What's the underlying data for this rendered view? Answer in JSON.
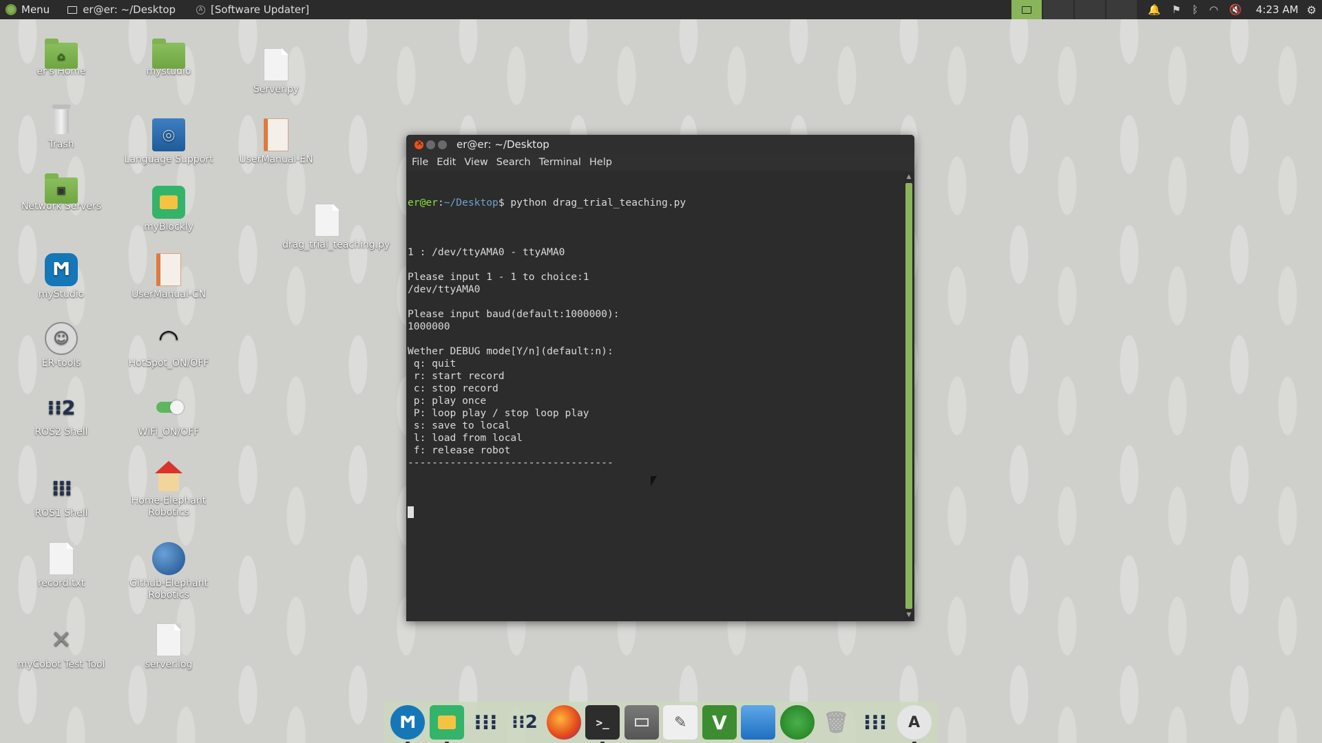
{
  "top_panel": {
    "menu_label": "Menu",
    "tasks": [
      {
        "label": "er@er: ~/Desktop"
      },
      {
        "label": "[Software Updater]"
      }
    ],
    "clock": "4:23 AM"
  },
  "desktop": {
    "icons": [
      {
        "label": "er's Home"
      },
      {
        "label": "mystudio"
      },
      {
        "label": "Server.py"
      },
      {
        "label": "Trash"
      },
      {
        "label": "Language Support"
      },
      {
        "label": "UserManual-EN"
      },
      {
        "label": "Network Servers"
      },
      {
        "label": "myBlockly"
      },
      {
        "label": "drag_trial_teaching.py"
      },
      {
        "label": "myStudio"
      },
      {
        "label": "UserManual-CN"
      },
      {
        "label": "ER-tools"
      },
      {
        "label": "HotSpot_ON/OFF"
      },
      {
        "label": "ROS2 Shell"
      },
      {
        "label": "WiFi_ON/OFF"
      },
      {
        "label": "ROS1 Shell"
      },
      {
        "label": "Home-Elephant Robotics"
      },
      {
        "label": "record.txt"
      },
      {
        "label": "Github-Elephant Robotics"
      },
      {
        "label": "myCobot Test Tool"
      },
      {
        "label": "server.log"
      }
    ]
  },
  "terminal": {
    "title": "er@er: ~/Desktop",
    "menu": [
      "File",
      "Edit",
      "View",
      "Search",
      "Terminal",
      "Help"
    ],
    "prompt_user": "er@er",
    "prompt_sep": ":",
    "prompt_path": "~/Desktop",
    "prompt_cmd": "$ python drag_trial_teaching.py",
    "lines": [
      "",
      "1 : /dev/ttyAMA0 - ttyAMA0",
      "",
      "Please input 1 - 1 to choice:1",
      "/dev/ttyAMA0",
      "",
      "Please input baud(default:1000000):",
      "1000000",
      "",
      "Wether DEBUG mode[Y/n](default:n):",
      " q: quit",
      " r: start record",
      " c: stop record",
      " p: play once",
      " P: loop play / stop loop play",
      " s: save to local",
      " l: load from local",
      " f: release robot",
      "----------------------------------",
      ""
    ]
  },
  "dock": {
    "items": [
      {
        "icon": "mystudio-icon"
      },
      {
        "icon": "myblockly-icon"
      },
      {
        "icon": "ros1-shell-icon"
      },
      {
        "icon": "ros2-shell-icon"
      },
      {
        "icon": "firefox-icon"
      },
      {
        "icon": "terminal-icon"
      },
      {
        "icon": "file-manager-icon"
      },
      {
        "icon": "text-editor-icon"
      },
      {
        "icon": "vim-icon"
      },
      {
        "icon": "window-icon"
      },
      {
        "icon": "green-circle-icon"
      },
      {
        "icon": "trash-icon"
      },
      {
        "icon": "ros-shell-icon"
      },
      {
        "icon": "software-updater-icon"
      }
    ]
  },
  "colors": {
    "accent": "#8ab45a",
    "terminal_bg": "#2c2c2c",
    "prompt_user": "#8ae234",
    "prompt_path": "#729fcf"
  }
}
